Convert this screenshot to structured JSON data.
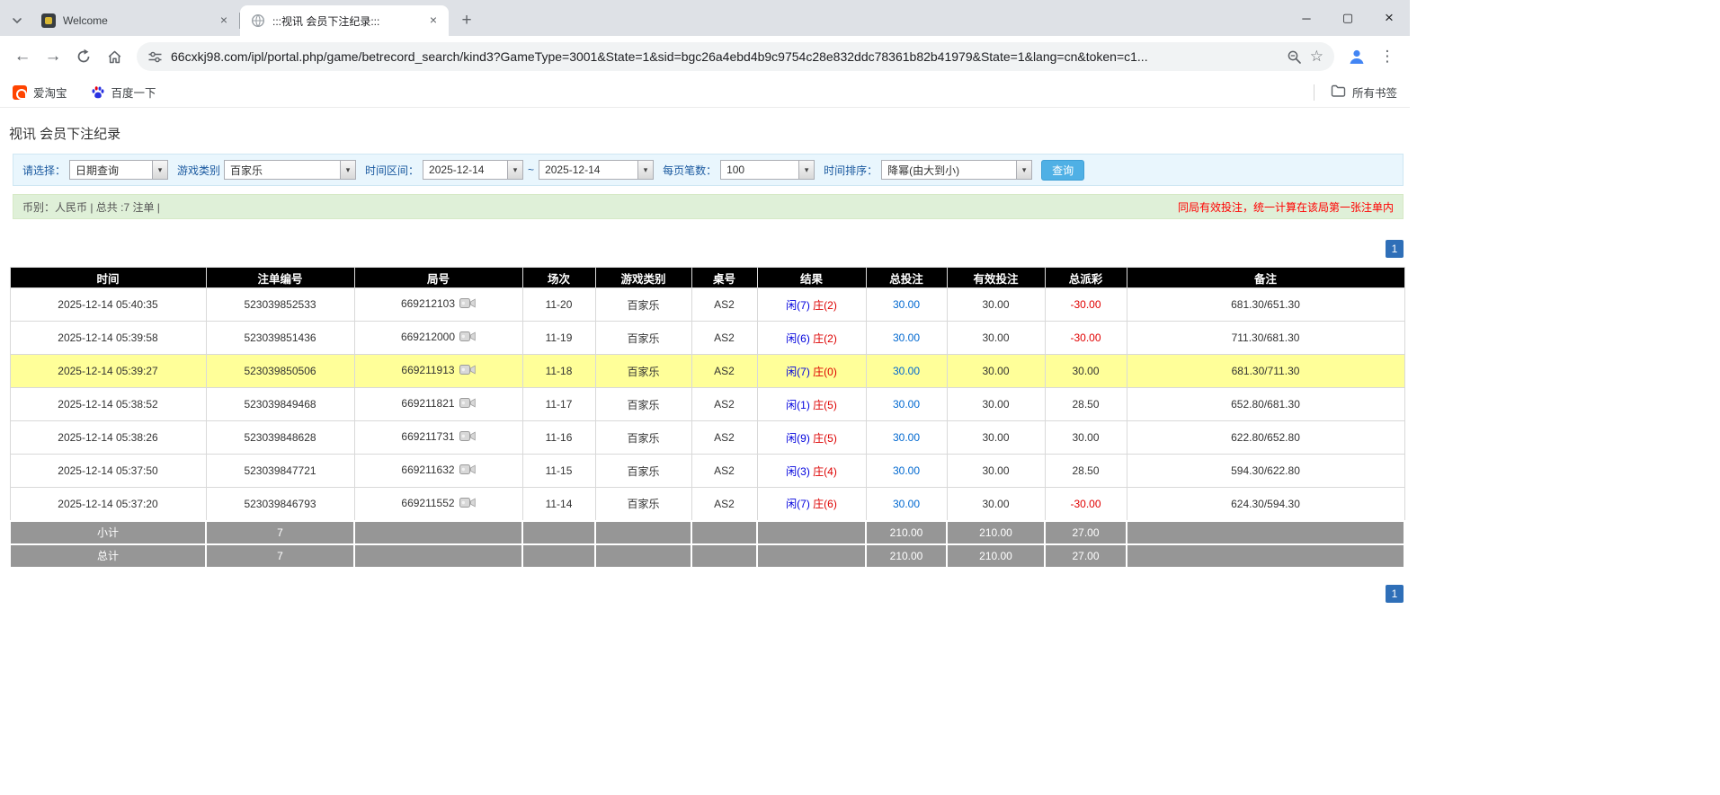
{
  "browser": {
    "tabs": [
      {
        "title": "Welcome"
      },
      {
        "title": ":::视讯 会员下注纪录:::"
      }
    ],
    "new_tab_glyph": "+",
    "window_controls": {
      "minimize": "─",
      "maximize": "▢",
      "close": "×"
    },
    "url": "66cxkj98.com/ipl/portal.php/game/betrecord_search/kind3?GameType=3001&State=1&sid=bgc26a4ebd4b9c9754c28e832ddc78361b82b41979&State=1&lang=cn&token=c1...",
    "bookmarks": {
      "items": [
        "爱淘宝",
        "百度一下"
      ],
      "all_bookmarks": "所有书签"
    }
  },
  "icons": [
    "chevron-down-icon",
    "globe-icon",
    "close-icon",
    "back-icon",
    "forward-icon",
    "reload-icon",
    "home-icon",
    "site-info-icon",
    "zoom-icon",
    "bookmark-star-icon",
    "profile-icon",
    "menu-icon",
    "folder-icon",
    "video-replay-icon"
  ],
  "colors": {
    "highlight_row": "#ffff99",
    "negative_red": "#e00000",
    "player_blue": "#0000dd",
    "banker_red": "#dd0000",
    "link_blue": "#0068d0",
    "accent_button": "#4fb0e5",
    "pager_blue": "#2f6fb8"
  },
  "page": {
    "title": "视讯 会员下注纪录",
    "filter": {
      "select_label": "请选择：",
      "query_type": "日期查询",
      "game_type_label": "游戏类别",
      "game_type": "百家乐",
      "range_label": "时间区间：",
      "date_from": "2025-12-14",
      "range_separator": "~",
      "date_to": "2025-12-14",
      "page_size_label": "每页笔数：",
      "page_size": "100",
      "sort_label": "时间排序：",
      "sort_order": "降幂(由大到小)",
      "search_button": "查询"
    },
    "summary": {
      "info": "币别：人民币 | 总共 :7 注单 |",
      "notice": "同局有效投注，统一计算在该局第一张注单内"
    },
    "pagination": {
      "page": "1"
    },
    "table": {
      "headers": [
        "时间",
        "注单编号",
        "局号",
        "场次",
        "游戏类别",
        "桌号",
        "结果",
        "总投注",
        "有效投注",
        "总派彩",
        "备注"
      ],
      "rows": [
        {
          "time": "2025-12-14 05:40:35",
          "bet_id": "523039852533",
          "round": "669212103",
          "session": "11-20",
          "game": "百家乐",
          "table_no": "AS2",
          "result_player": "闲(7)",
          "result_banker": "庄(2)",
          "total_bet": "30.00",
          "valid_bet": "30.00",
          "payout": "-30.00",
          "note": "681.30/651.30",
          "highlight": false
        },
        {
          "time": "2025-12-14 05:39:58",
          "bet_id": "523039851436",
          "round": "669212000",
          "session": "11-19",
          "game": "百家乐",
          "table_no": "AS2",
          "result_player": "闲(6)",
          "result_banker": "庄(2)",
          "total_bet": "30.00",
          "valid_bet": "30.00",
          "payout": "-30.00",
          "note": "711.30/681.30",
          "highlight": false
        },
        {
          "time": "2025-12-14 05:39:27",
          "bet_id": "523039850506",
          "round": "669211913",
          "session": "11-18",
          "game": "百家乐",
          "table_no": "AS2",
          "result_player": "闲(7)",
          "result_banker": "庄(0)",
          "total_bet": "30.00",
          "valid_bet": "30.00",
          "payout": "30.00",
          "note": "681.30/711.30",
          "highlight": true
        },
        {
          "time": "2025-12-14 05:38:52",
          "bet_id": "523039849468",
          "round": "669211821",
          "session": "11-17",
          "game": "百家乐",
          "table_no": "AS2",
          "result_player": "闲(1)",
          "result_banker": "庄(5)",
          "total_bet": "30.00",
          "valid_bet": "30.00",
          "payout": "28.50",
          "note": "652.80/681.30",
          "highlight": false
        },
        {
          "time": "2025-12-14 05:38:26",
          "bet_id": "523039848628",
          "round": "669211731",
          "session": "11-16",
          "game": "百家乐",
          "table_no": "AS2",
          "result_player": "闲(9)",
          "result_banker": "庄(5)",
          "total_bet": "30.00",
          "valid_bet": "30.00",
          "payout": "30.00",
          "note": "622.80/652.80",
          "highlight": false
        },
        {
          "time": "2025-12-14 05:37:50",
          "bet_id": "523039847721",
          "round": "669211632",
          "session": "11-15",
          "game": "百家乐",
          "table_no": "AS2",
          "result_player": "闲(3)",
          "result_banker": "庄(4)",
          "total_bet": "30.00",
          "valid_bet": "30.00",
          "payout": "28.50",
          "note": "594.30/622.80",
          "highlight": false
        },
        {
          "time": "2025-12-14 05:37:20",
          "bet_id": "523039846793",
          "round": "669211552",
          "session": "11-14",
          "game": "百家乐",
          "table_no": "AS2",
          "result_player": "闲(7)",
          "result_banker": "庄(6)",
          "total_bet": "30.00",
          "valid_bet": "30.00",
          "payout": "-30.00",
          "note": "624.30/594.30",
          "highlight": false
        }
      ],
      "footer": [
        {
          "label": "小计",
          "count": "7",
          "total_bet": "210.00",
          "valid_bet": "210.00",
          "payout": "27.00"
        },
        {
          "label": "总计",
          "count": "7",
          "total_bet": "210.00",
          "valid_bet": "210.00",
          "payout": "27.00"
        }
      ]
    }
  }
}
